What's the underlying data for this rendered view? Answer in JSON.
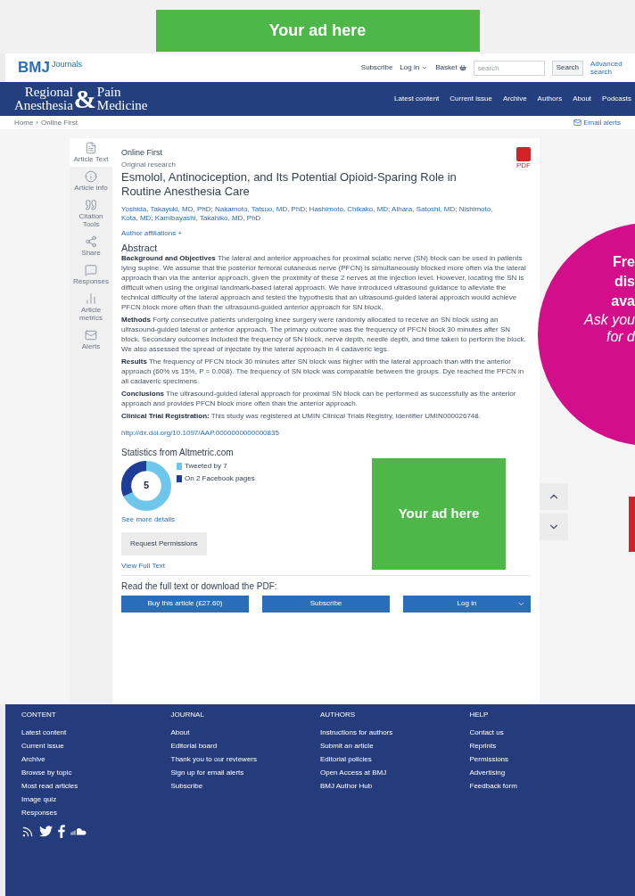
{
  "top_ad": {
    "text": "Your ad here"
  },
  "header": {
    "brand": "BMJ",
    "brand_suffix": "Journals",
    "links": [
      "Subscribe",
      "Log in",
      "Basket"
    ],
    "search": {
      "placeholder": "search"
    },
    "search_button": "Search",
    "advanced": "Advanced search"
  },
  "journal": {
    "title_left_1": "Regional",
    "title_left_2": "Anesthesia",
    "ampersand": "&",
    "title_right_1": "Pain",
    "title_right_2": "Medicine",
    "nav": [
      "Latest content",
      "Current issue",
      "Archive",
      "Authors",
      "About",
      "Podcasts"
    ]
  },
  "breadcrumb": [
    "Home",
    "Online First"
  ],
  "breadcrumb_separator": "›",
  "email_alerts": "Email alerts",
  "sidebar": {
    "items": [
      {
        "label": "Article Text",
        "selected": true
      },
      {
        "label": "Article info",
        "selected": false
      },
      {
        "label": "Citation Tools",
        "selected": false
      },
      {
        "label": "Share",
        "selected": false
      },
      {
        "label": "Responses",
        "selected": false
      },
      {
        "label": "Article metrics",
        "selected": false
      },
      {
        "label": "Alerts",
        "selected": false
      }
    ]
  },
  "article": {
    "section": "Online First",
    "type": "Original research",
    "pdf_label": "PDF",
    "title": "Esmolol, Antinociception, and Its Potential Opioid-Sparing Role in Routine Anesthesia Care",
    "authors": "Yoshida, Takayuki, MD, PhD; Nakamoto, Tatsuo, MD, PhD; Hashimoto, Chikako, MD; Aihara, Satoshi, MD; Nishimoto, Kota, MD; Kamibayashi, Takahiko, MD, PhD",
    "affiliations": "Author affiliations +",
    "abstract_heading": "Abstract",
    "abstract": [
      {
        "label": "Background and Objectives",
        "text": "The lateral and anterior approaches for proximal sciatic nerve (SN) block can be used in patients lying supine. We assume that the posterior femoral cutaneous nerve (PFCN) is simultaneously blocked more often via the lateral approach than via the anterior approach, given the proximity of these 2 nerves at the injection level. However, locating the SN is difficult when using the original landmark-based lateral approach. We have introduced ultrasound guidance to alleviate the technical difficulty of the lateral approach and tested the hypothesis that an ultrasound-guided lateral approach would achieve PFCN block more often than the ultrasound-guided anterior approach for SN block."
      },
      {
        "label": "Methods",
        "text": "Forty consecutive patients undergoing knee surgery were randomly allocated to receive an SN block using an ultrasound-guided lateral or anterior approach. The primary outcome was the frequency of PFCN block 30 minutes after SN block. Secondary outcomes included the frequency of SN block, nerve depth, needle depth, and time taken to perform the block. We also assessed the spread of injectate by the lateral approach in 4 cadaveric legs."
      },
      {
        "label": "Results",
        "text": "The frequency of PFCN block 30 minutes after SN block was higher with the lateral approach than with the anterior approach (60% vs 15%, P = 0.008). The frequency of SN block was comparable between the groups. Dye reached the PFCN in all cadaveric specimens."
      },
      {
        "label": "Conclusions",
        "text": "The ultrasound-guided lateral approach for proximal SN block can be performed as successfully as the anterior approach and provides PFCN block more often than the anterior approach."
      },
      {
        "label": "Clinical Trial Registration:",
        "text": "This study was registered at UMIN Clinical Trials Registry, identifier UMIN000026748."
      }
    ],
    "doi": "http://dx.doi.org/10.1097/AAP.0000000000000835",
    "stats_heading": "Statistics from Altmetric.com",
    "altmetric_score": "5",
    "legend": [
      {
        "label": "Tweeted by 7",
        "color": "#6ec6ea"
      },
      {
        "label": "On 2 Facebook pages",
        "color": "#1f3c99"
      }
    ],
    "more_details": "See more details",
    "request_permissions": "Request Permissions",
    "view_full_text": "View Full Text",
    "read_heading": "Read the full text or download the PDF:",
    "buttons": [
      "Buy this article (£27.60)",
      "Subscribe",
      "Log in"
    ],
    "side_ad": "Your ad here"
  },
  "promo": {
    "lines": [
      "Fre",
      "dis",
      "ava"
    ],
    "italic_lines": [
      "Ask you",
      "for d"
    ]
  },
  "footer": {
    "columns": [
      {
        "heading": "CONTENT",
        "links": [
          "Latest content",
          "Current issue",
          "Archive",
          "Browse by topic",
          "Most read articles",
          "Image quiz",
          "Responses"
        ]
      },
      {
        "heading": "JOURNAL",
        "links": [
          "About",
          "Editorial board",
          "Thank you to our reviewers",
          "Sign up for email alerts",
          "Subscribe"
        ]
      },
      {
        "heading": "AUTHORS",
        "links": [
          "Instructions for authors",
          "Submit an article",
          "Editorial policies",
          "Open Access at BMJ",
          "BMJ Author Hub"
        ]
      },
      {
        "heading": "HELP",
        "links": [
          "Contact us",
          "Reprints",
          "Permissions",
          "Advertising",
          "Feedback form"
        ]
      }
    ]
  }
}
